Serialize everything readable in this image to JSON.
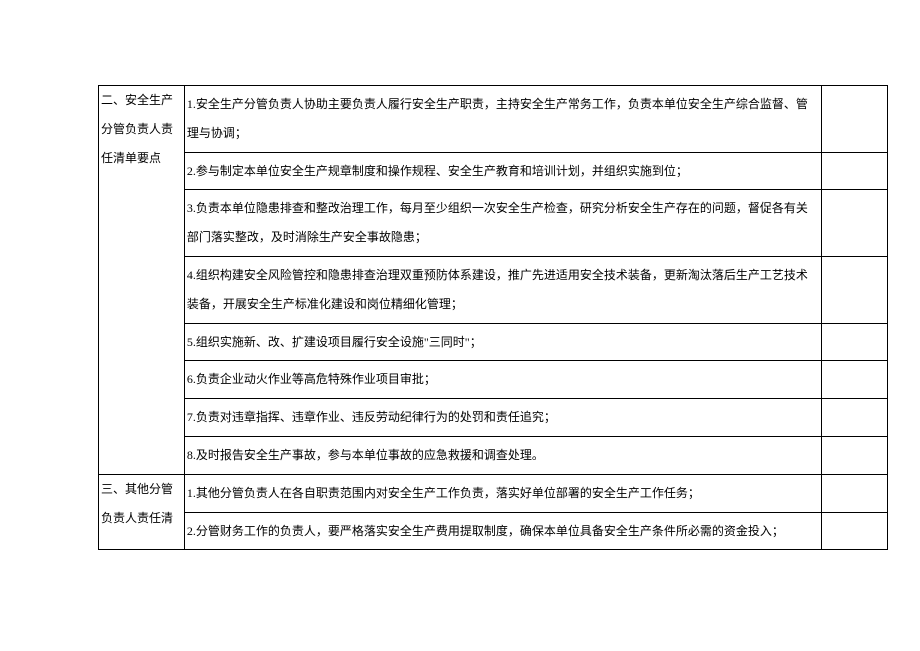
{
  "sections": [
    {
      "heading": "二、安全生产分管负责人责任清单要点",
      "items": [
        "1.安全生产分管负责人协助主要负责人履行安全生产职责，主持安全生产常务工作，负责本单位安全生产综合监督、管理与协调；",
        "2.参与制定本单位安全生产规章制度和操作规程、安全生产教育和培训计划，并组织实施到位；",
        "3.负责本单位隐患排查和整改治理工作，每月至少组织一次安全生产检查，研究分析安全生产存在的问题，督促各有关部门落实整改，及时消除生产安全事故隐患；",
        "4.组织构建安全风险管控和隐患排查治理双重预防体系建设，推广先进适用安全技术装备，更新淘汰落后生产工艺技术装备，开展安全生产标准化建设和岗位精细化管理；",
        "5.组织实施新、改、扩建设项目履行安全设施\"三同时\"；",
        "6.负责企业动火作业等高危特殊作业项目审批；",
        "7.负责对违章指挥、违章作业、违反劳动纪律行为的处罚和责任追究；",
        "8.及时报告安全生产事故，参与本单位事故的应急救援和调查处理。"
      ]
    },
    {
      "heading": "三、其他分管负责人责任清",
      "items": [
        "1.其他分管负责人在各自职责范围内对安全生产工作负责，落实好单位部署的安全生产工作任务；",
        "2.分管财务工作的负责人，要严格落实安全生产费用提取制度，确保本单位具备安全生产条件所必需的资金投入；"
      ]
    }
  ]
}
